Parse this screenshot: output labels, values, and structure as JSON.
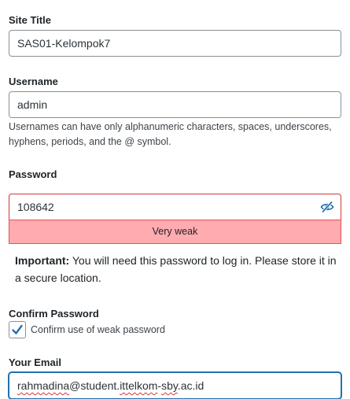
{
  "site_title": {
    "label": "Site Title",
    "value": "SAS01-Kelompok7"
  },
  "username": {
    "label": "Username",
    "value": "admin",
    "help": "Usernames can have only alphanumeric characters, spaces, underscores, hyphens, periods, and the @ symbol."
  },
  "password": {
    "label": "Password",
    "value": "108642",
    "toggle_icon": "eye-slash-icon",
    "strength": "Very weak",
    "important_label": "Important:",
    "important_text": " You will need this password to log in. Please store it in a secure location.",
    "error_color": "#d63638",
    "strength_bg": "#ffabaf"
  },
  "confirm_password": {
    "label": "Confirm Password",
    "checkbox_label": "Confirm use of weak password",
    "checked": true,
    "check_color": "#2271b1"
  },
  "email": {
    "label": "Your Email",
    "value_parts": [
      "rahmadina",
      "@student.",
      "ittelkom",
      "-",
      "sby",
      ".ac.id"
    ],
    "focus_color": "#2271b1"
  }
}
